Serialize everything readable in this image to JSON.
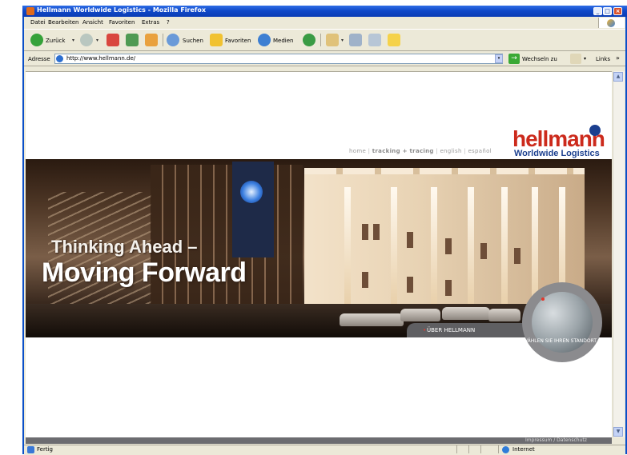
{
  "window": {
    "title": "Hellmann Worldwide Logistics - Mozilla Firefox",
    "min_glyph": "_",
    "max_glyph": "□",
    "close_glyph": "×"
  },
  "menu": [
    "Datei",
    "Bearbeiten",
    "Ansicht",
    "Favoriten",
    "Extras",
    "?"
  ],
  "toolbar": {
    "back_label": "Zurück",
    "search_label": "Suchen",
    "favorites_label": "Favoriten",
    "media_label": "Medien",
    "dropdown_glyph": "▾"
  },
  "address": {
    "label": "Adresse",
    "value": "http://www.hellmann.de/",
    "go_label": "Wechseln zu",
    "links_label": "Links",
    "more_glyph": "»"
  },
  "page": {
    "logo_word": "hellmann",
    "logo_sub": "Worldwide Logistics",
    "nav": [
      "home",
      "tracking + tracing",
      "english",
      "español"
    ],
    "nav_separator": "|",
    "tagline_line1": "Thinking Ahead –",
    "tagline_line2": "Moving Forward",
    "about_label": "ÜBER HELLMANN",
    "globe_label": "WÄHLEN SIE IHREN STANDORT",
    "footer_links": "Impressum / Datenschutz"
  },
  "status": {
    "text": "Fertig",
    "zone": "Internet"
  },
  "colors": {
    "brand_red": "#cc2a1c",
    "brand_blue": "#1b3f8f",
    "titlebar_blue": "#0b4fc7"
  }
}
